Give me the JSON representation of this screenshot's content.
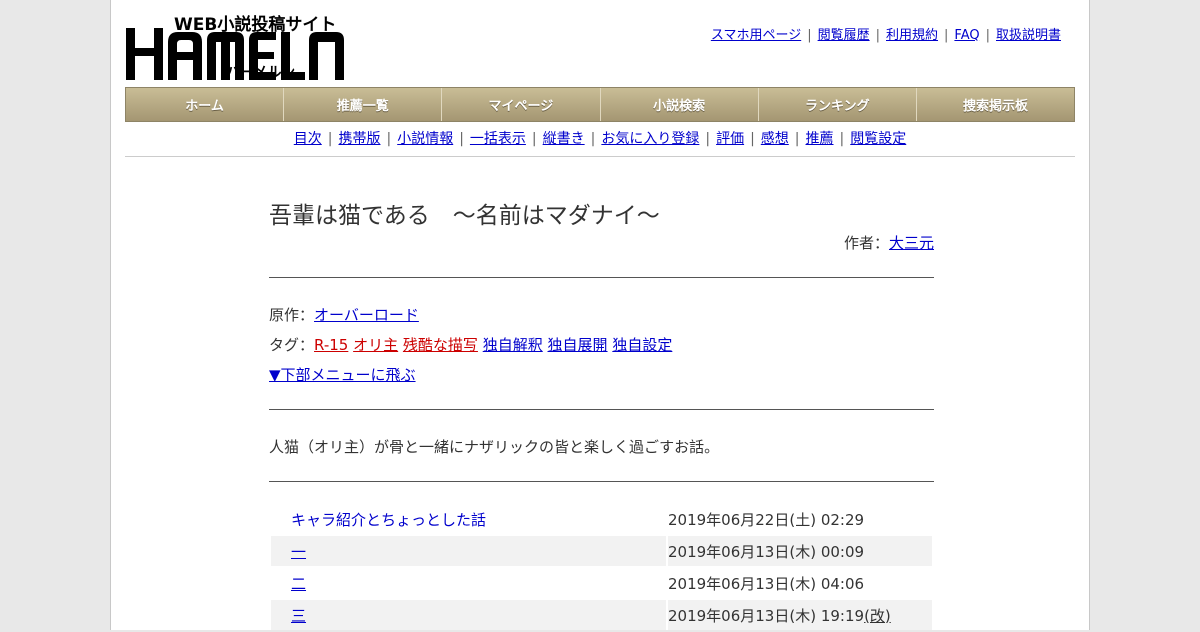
{
  "logo": {
    "tagline": "WEB小説投稿サイト",
    "brand": "HAMELN",
    "kana": "ハーメルン"
  },
  "toplinks": [
    "スマホ用ページ",
    "閲覧履歴",
    "利用規約",
    "FAQ",
    "取扱説明書"
  ],
  "mainnav": [
    "ホーム",
    "推薦一覧",
    "マイページ",
    "小説検索",
    "ランキング",
    "捜索掲示板"
  ],
  "subnav": [
    "目次",
    "携帯版",
    "小説情報",
    "一括表示",
    "縦書き",
    "お気に入り登録",
    "評価",
    "感想",
    "推薦",
    "閲覧設定"
  ],
  "novel": {
    "title": "吾輩は猫である　～名前はマダナイ～",
    "author_label": "作者：",
    "author": "大三元",
    "original_label": "原作：",
    "original": "オーバーロード",
    "tags_label": "タグ：",
    "tags_red": [
      "R-15",
      "オリ主",
      "残酷な描写"
    ],
    "tags": [
      "独自解釈",
      "独自展開",
      "独自設定"
    ],
    "jump": "▼下部メニューに飛ぶ",
    "summary": "人猫（オリ主）が骨と一緒にナザリックの皆と楽しく過ごすお話。"
  },
  "chapters": [
    {
      "title": "キャラ紹介とちょっとした話",
      "date": "2019年06月22日(土) 02:29",
      "rev": ""
    },
    {
      "title": "一",
      "date": "2019年06月13日(木) 00:09",
      "rev": ""
    },
    {
      "title": "二",
      "date": "2019年06月13日(木) 04:06",
      "rev": ""
    },
    {
      "title": "三",
      "date": "2019年06月13日(木) 19:19",
      "rev": "(改)"
    }
  ],
  "colors": {
    "nav_top": "#c9bd96",
    "nav_bottom": "#a49672",
    "link": "#0000cc",
    "tag_red": "#cc0000"
  }
}
